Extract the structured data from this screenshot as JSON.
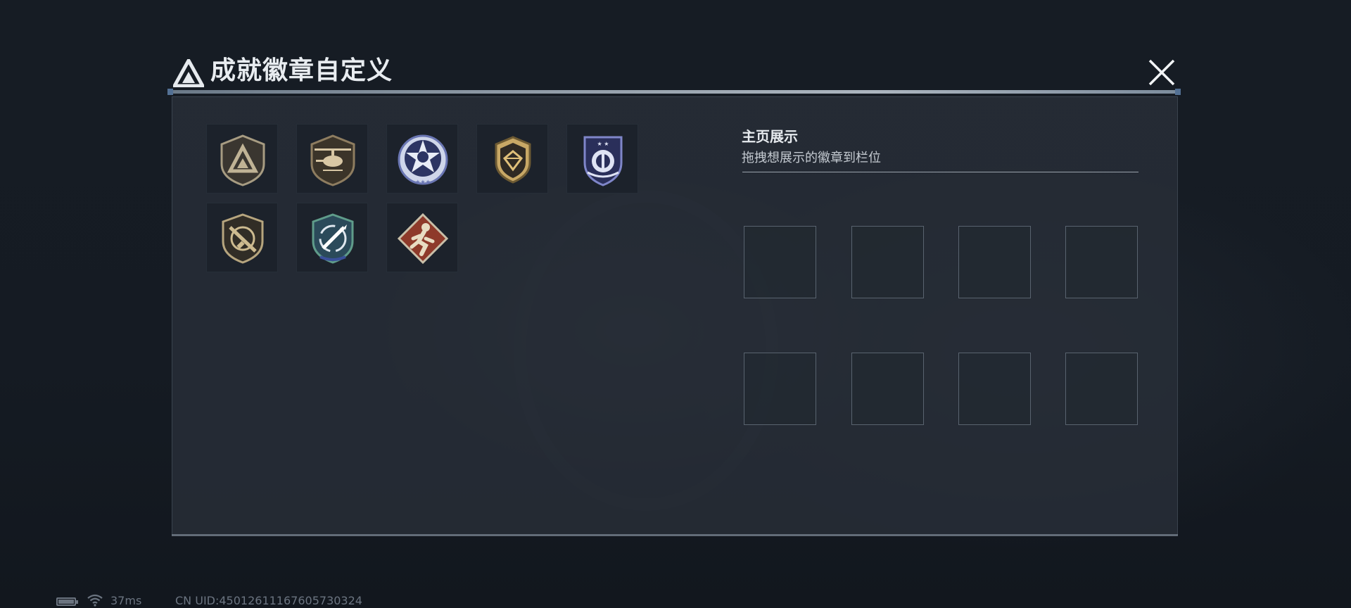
{
  "dialog": {
    "title": "成就徽章自定义",
    "close_icon": "close-icon"
  },
  "badges": [
    {
      "name": "triangle-logo-badge",
      "icon": "triangle-logo-icon",
      "color": "#a79c82"
    },
    {
      "name": "helicopter-badge",
      "icon": "helicopter-icon",
      "color": "#b9a785"
    },
    {
      "name": "star-skull-badge",
      "icon": "star-skull-icon",
      "color": "#9aa8d6"
    },
    {
      "name": "diamond-shield-badge",
      "icon": "diamond-shield-icon",
      "color": "#c8a866"
    },
    {
      "name": "eagle-shield-badge",
      "icon": "eagle-shield-icon",
      "color": "#7f86c9"
    },
    {
      "name": "rifle-badge",
      "icon": "rifle-icon",
      "color": "#b6a57e"
    },
    {
      "name": "missile-badge",
      "icon": "missile-icon",
      "color": "#5f9c8a"
    },
    {
      "name": "runner-badge",
      "icon": "runner-icon",
      "color": "#b4523f"
    }
  ],
  "homepage_display": {
    "title": "主页展示",
    "subtitle": "拖拽想展示的徽章到栏位",
    "slot_count": 8
  },
  "status_bar": {
    "battery_icon": "battery-icon",
    "wifi_icon": "wifi-icon",
    "ping": "37ms",
    "uid": "CN UID:450126111676057303​24"
  }
}
